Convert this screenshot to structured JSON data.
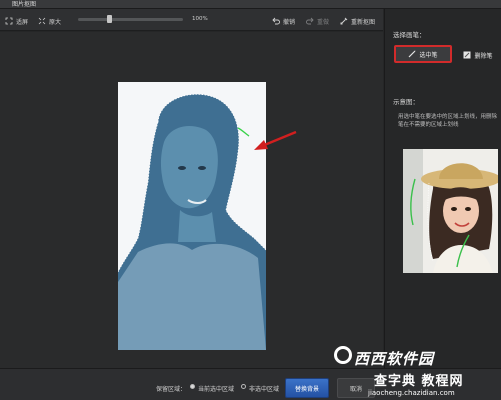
{
  "window": {
    "title": "图片抠图"
  },
  "toolbar": {
    "fit_label": "适屏",
    "original_label": "原大",
    "zoom_level": "100%",
    "zoom_fraction": 0.3,
    "undo_label": "撤销",
    "redo_label": "重做",
    "restart_label": "重新抠图"
  },
  "sidebar": {
    "heading": "选择画笔：",
    "select_brush_label": "选中笔",
    "erase_brush_label": "删除笔",
    "example_heading": "示意图：",
    "hint_text": "用选中笔在要选中的区域上划线，用删除笔在不需要的区域上划线"
  },
  "bottom": {
    "keep_label": "保留区域：",
    "option_selected": "当前选中区域",
    "option_unselected": "非选中区域",
    "replace_button": "替换背景",
    "cancel_button": "取消"
  },
  "watermark": {
    "site_name": "西西软件园",
    "site_name2": "查字典 教程网",
    "url": "jiaocheng.chazidian.com"
  },
  "colors": {
    "accent_blue": "#2452a4",
    "highlight_red": "#d22b2b",
    "selection_overlay": "#3d6f93"
  },
  "icons": [
    "fit-icon",
    "original-size-icon",
    "undo-icon",
    "redo-icon",
    "restart-icon",
    "brush-icon",
    "eraser-brush-icon"
  ]
}
